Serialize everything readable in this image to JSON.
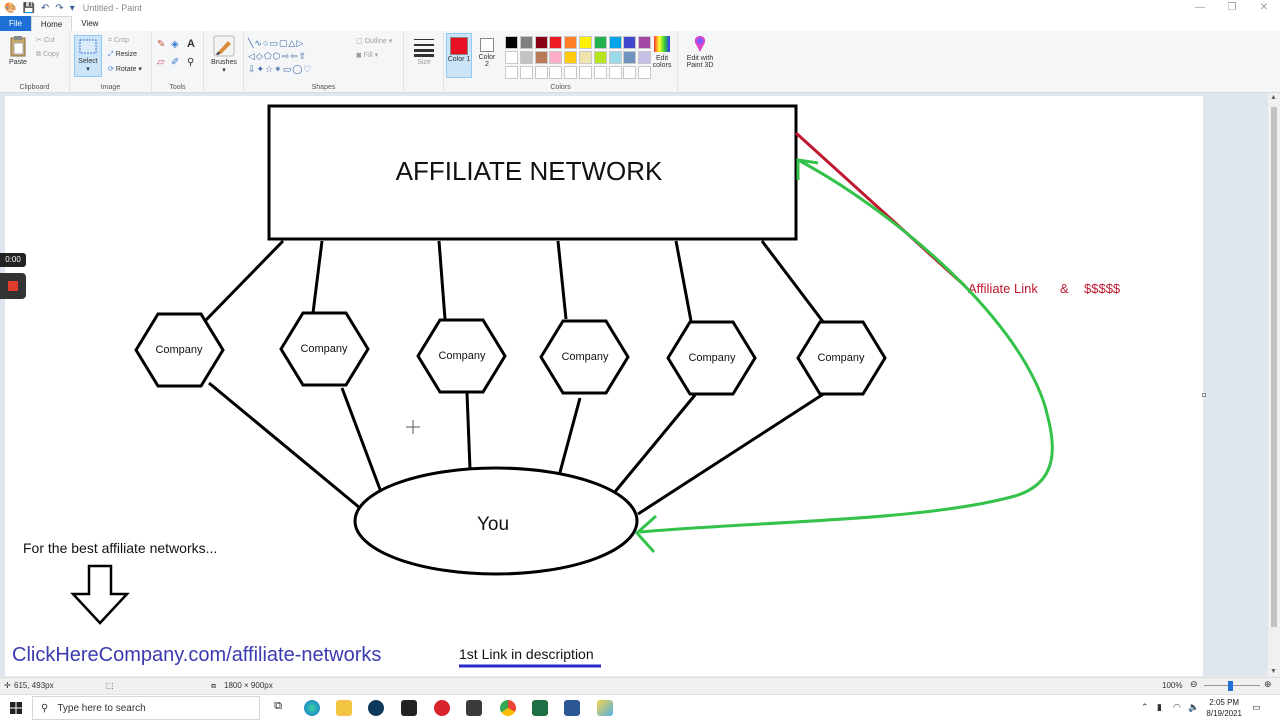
{
  "app": {
    "title": "Untitled - Paint",
    "window_controls": {
      "minimize": "—",
      "maximize": "❐",
      "close": "✕"
    }
  },
  "menu_tabs": [
    "File",
    "Home",
    "View"
  ],
  "ribbon": {
    "clipboard": {
      "label": "Clipboard",
      "paste": "Paste",
      "cut": "Cut",
      "copy": "Copy"
    },
    "image": {
      "label": "Image",
      "select": "Select",
      "crop": "Crop",
      "resize": "Resize",
      "rotate": "Rotate"
    },
    "tools": {
      "label": "Tools"
    },
    "brushes": {
      "label": "Brushes"
    },
    "shapes": {
      "label": "Shapes",
      "outline": "Outline",
      "fill": "Fill"
    },
    "size": {
      "label": "Size"
    },
    "colors": {
      "label": "Colors",
      "color1": "Color 1",
      "color2": "Color 2",
      "color1_value": "#e81123",
      "color2_value": "#ffffff",
      "edit_colors": "Edit colors",
      "edit_paint3d": "Edit with Paint 3D",
      "palette_row1": [
        "#000000",
        "#7f7f7f",
        "#880015",
        "#ed1c24",
        "#ff7f27",
        "#fff200",
        "#22b14c",
        "#00a2e8",
        "#3f48cc",
        "#a349a4"
      ],
      "palette_row2": [
        "#ffffff",
        "#c3c3c3",
        "#b97a57",
        "#ffaec9",
        "#ffc90e",
        "#efe4b0",
        "#b5e61d",
        "#99d9ea",
        "#7092be",
        "#c8bfe7"
      ]
    }
  },
  "canvas": {
    "network_title": "AFFILIATE NETWORK",
    "companies": [
      "Company",
      "Company",
      "Company",
      "Company",
      "Company",
      "Company"
    ],
    "you_label": "You",
    "affiliate_link_label": "Affiliate Link",
    "ampersand": "&",
    "money_label": "$$$$$",
    "best_networks_text": "For the best affiliate networks...",
    "url_text": "ClickHereCompany.com/affiliate-networks",
    "first_link_text": "1st Link in description",
    "colors": {
      "red_line": "#c0182f",
      "green_arrow": "#34c24a",
      "url_blue": "#3b3bb0",
      "underline_blue": "#2a2ac8"
    }
  },
  "status_bar": {
    "cursor_pos": "615, 493px",
    "canvas_size": "1800 × 900px",
    "zoom": "100%"
  },
  "recorder": {
    "time": "0:00"
  },
  "taskbar": {
    "search_placeholder": "Type here to search",
    "time": "2:05 PM",
    "date": "8/19/2021"
  }
}
